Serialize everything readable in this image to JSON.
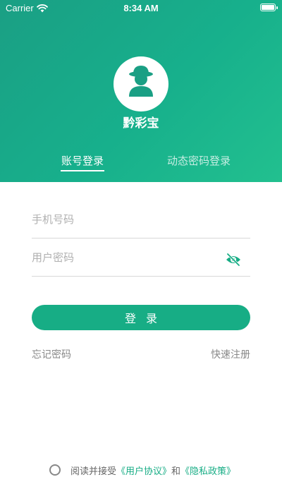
{
  "status_bar": {
    "carrier": "Carrier",
    "time": "8:34 AM",
    "wifi_icon": "wifi-icon",
    "battery_icon": "battery-icon"
  },
  "app": {
    "name": "黔彩宝",
    "avatar_icon": "user-avatar-icon"
  },
  "tabs": [
    {
      "label": "账号登录",
      "active": true
    },
    {
      "label": "动态密码登录",
      "active": false
    }
  ],
  "form": {
    "phone_placeholder": "手机号码",
    "password_placeholder": "用户密码",
    "password_toggle_icon": "eye-off-icon"
  },
  "login_button": "登录",
  "links": {
    "forgot": "忘记密码",
    "register": "快速注册"
  },
  "agreement": {
    "prefix": "阅读并接受",
    "user_agreement": "《用户协议》",
    "conjunction": "和",
    "privacy_policy": "《隐私政策》"
  },
  "colors": {
    "accent": "#17ad85",
    "header_gradient_start": "#1a9f84",
    "header_gradient_end": "#22c08f"
  }
}
